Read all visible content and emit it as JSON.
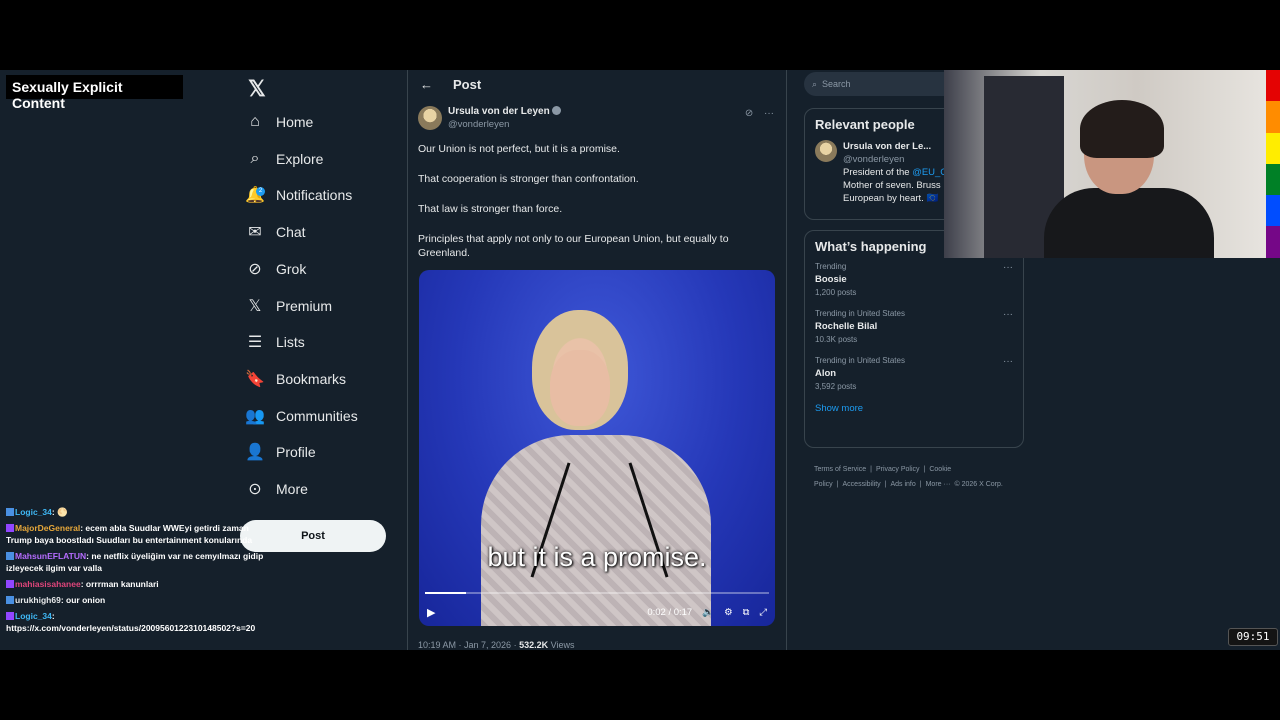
{
  "overlay": {
    "content_warning": "Sexually Explicit Content",
    "clock": "09:51",
    "chat": [
      {
        "user": "Logic_34",
        "text": "🌕",
        "color": "#3fb8f5"
      },
      {
        "user": "MajorDeGeneral",
        "text": "ecem abla Suudlar WWEyi getirdi zaman Trump baya boostladı Suudları bu entertainment konularında",
        "color": "#e7a83a"
      },
      {
        "user": "MahsunEFLATUN",
        "text": "ne netflix üyeliğim var ne cemyılmazı gidip izleyecek ilgim var valla",
        "color": "#b56cff"
      },
      {
        "user": "mahiasisahanee",
        "text": "orrrman kanunlari",
        "color": "#e0457b"
      },
      {
        "user": "urukhigh69",
        "text": "our onion",
        "color": "#e7e9ea"
      },
      {
        "user": "Logic_34",
        "text": "https://x.com/vonderleyen/status/2009560122310148502?s=20",
        "color": "#3fb8f5"
      }
    ]
  },
  "nav": {
    "items": [
      {
        "label": "Home",
        "icon": "home-icon"
      },
      {
        "label": "Explore",
        "icon": "search-icon"
      },
      {
        "label": "Notifications",
        "icon": "bell-icon",
        "badge": "2"
      },
      {
        "label": "Chat",
        "icon": "mail-icon"
      },
      {
        "label": "Grok",
        "icon": "grok-icon"
      },
      {
        "label": "Premium",
        "icon": "x-icon"
      },
      {
        "label": "Lists",
        "icon": "list-icon"
      },
      {
        "label": "Bookmarks",
        "icon": "bookmark-icon"
      },
      {
        "label": "Communities",
        "icon": "people-icon"
      },
      {
        "label": "Profile",
        "icon": "person-icon"
      },
      {
        "label": "More",
        "icon": "more-circle-icon"
      }
    ],
    "post_button": "Post"
  },
  "main": {
    "header_title": "Post",
    "author_name": "Ursula von der Leyen",
    "author_handle": "@vonderleyen",
    "paragraphs": [
      "Our Union is not perfect, but it is a promise.",
      "That cooperation is stronger than confrontation.",
      "That law is stronger than force.",
      "Principles that apply not only to our European Union, but equally to Greenland."
    ],
    "video": {
      "caption": "but it is a promise.",
      "time": "0:02 / 0:17",
      "progress": 0.12
    },
    "timestamp": "10:19 AM · Jan 7, 2026 · ",
    "views_count": "532.2K",
    "views_label": "Views"
  },
  "right": {
    "search_placeholder": "Search",
    "relevant_title": "Relevant people",
    "relevant_name": "Ursula von der Le...",
    "relevant_handle": "@vonderleyen",
    "relevant_bio_1": "President of the ",
    "relevant_bio_link": "@EU_C",
    "relevant_bio_2": "Mother of seven. Bruss",
    "relevant_bio_3": "European by heart. 🇪🇺",
    "happening_title": "What’s happening",
    "trends": [
      {
        "context": "Trending",
        "title": "Boosie",
        "count": "1,200 posts"
      },
      {
        "context": "Trending in United States",
        "title": "Rochelle Bilal",
        "count": "10.3K posts"
      },
      {
        "context": "Trending in United States",
        "title": "Alon",
        "count": "3,592 posts"
      }
    ],
    "show_more": "Show more",
    "footer": [
      "Terms of Service",
      "|",
      "Privacy Policy",
      "|",
      "Cookie Policy",
      "|",
      "Accessibility",
      "|",
      "Ads info",
      "|",
      "More ···",
      "© 2026 X Corp."
    ]
  }
}
